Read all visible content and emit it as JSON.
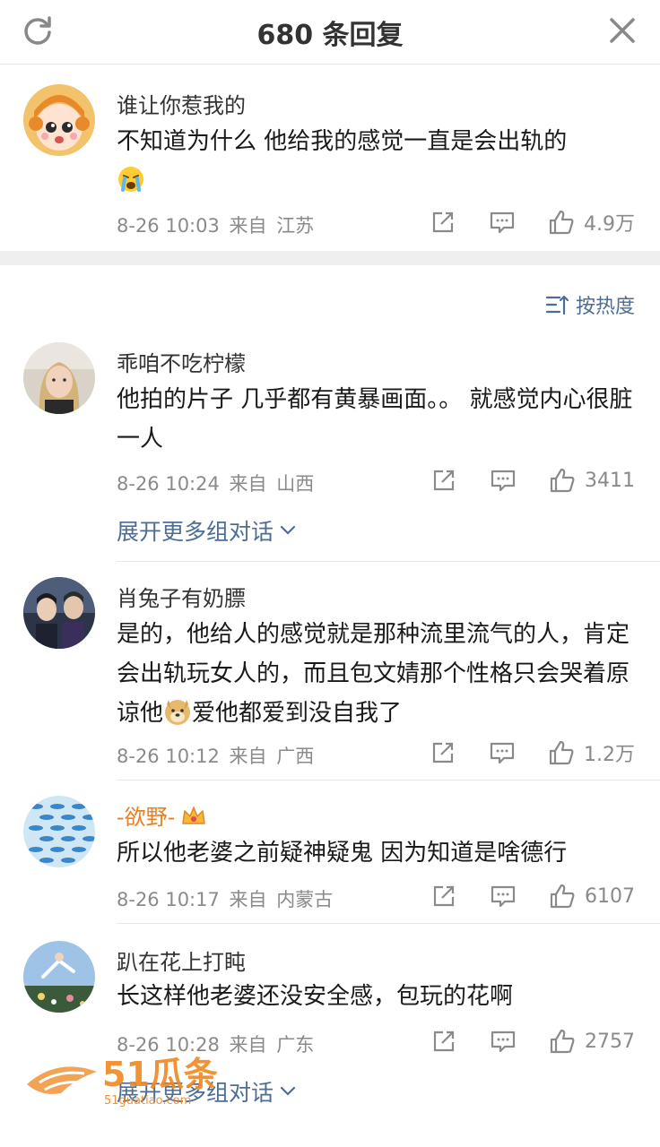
{
  "header": {
    "title": "680 条回复"
  },
  "top_comment": {
    "name": "谁让你惹我的",
    "text": "不知道为什么 他给我的感觉一直是会出轨的",
    "date": "8-26 10:03",
    "from": "来自",
    "location": "江苏",
    "likes": "4.9万"
  },
  "sort": {
    "label": "按热度"
  },
  "replies": [
    {
      "name": "乖咱不吃柠檬",
      "text": "他拍的片子 几乎都有黄暴画面。。 就感觉内心很脏一人",
      "date": "8-26 10:24",
      "from": "来自",
      "location": "山西",
      "likes": "3411",
      "expand": "展开更多组对话"
    },
    {
      "name": "肖兔子有奶膘",
      "text_a": "是的，他给人的感觉就是那种流里流气的人，肯定会出轨玩女人的，而且包文婧那个性格只会哭着原谅他",
      "text_b": "爱他都爱到没自我了",
      "date": "8-26 10:12",
      "from": "来自",
      "location": "广西",
      "likes": "1.2万"
    },
    {
      "name": "-欲野-",
      "text": "所以他老婆之前疑神疑鬼 因为知道是啥德行",
      "date": "8-26 10:17",
      "from": "来自",
      "location": "内蒙古",
      "likes": "6107"
    },
    {
      "name": "趴在花上打盹",
      "text": "长这样他老婆还没安全感，包玩的花啊",
      "date": "8-26 10:28",
      "from": "来自",
      "location": "广东",
      "likes": "2757",
      "expand": "展开更多组对话"
    }
  ],
  "watermark": {
    "text": "51瓜条",
    "url": "51guatiao.com"
  },
  "colors": {
    "link": "#4d6d94",
    "meta": "#8a8a8a",
    "divider": "#e8e8e8"
  }
}
